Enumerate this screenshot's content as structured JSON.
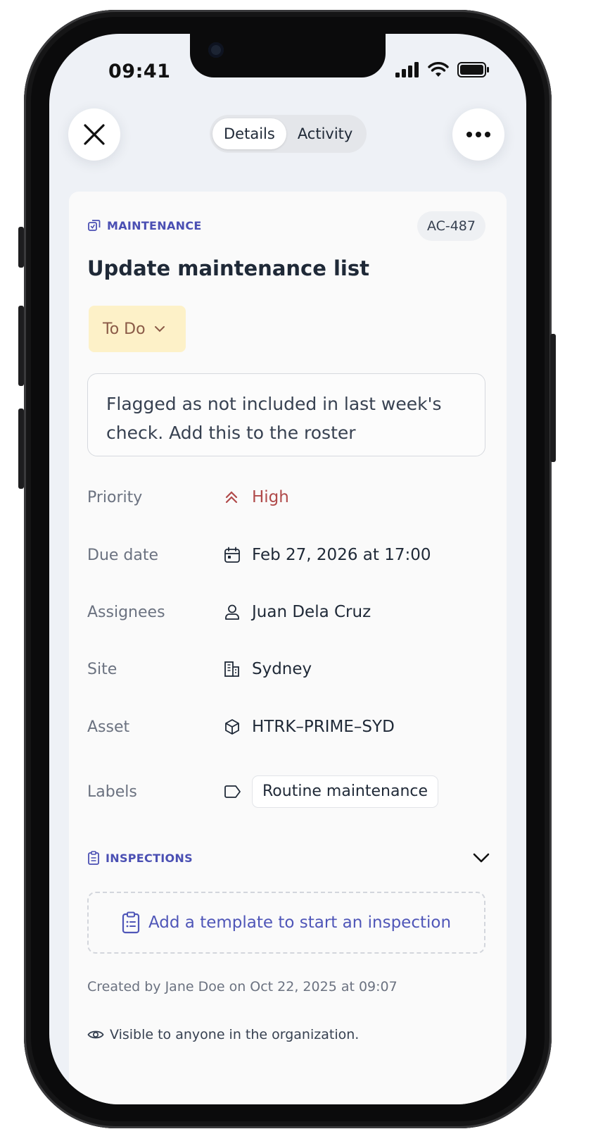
{
  "status_bar": {
    "time": "09:41"
  },
  "header": {
    "tabs": [
      {
        "label": "Details",
        "active": true
      },
      {
        "label": "Activity",
        "active": false
      }
    ]
  },
  "task": {
    "category": "MAINTENANCE",
    "id": "AC-487",
    "title": "Update maintenance list",
    "status": "To Do",
    "description": "Flagged as not included in last week's check. Add this to the roster"
  },
  "fields": {
    "priority": {
      "label": "Priority",
      "value": "High"
    },
    "due_date": {
      "label": "Due date",
      "value": "Feb 27, 2026 at 17:00"
    },
    "assignees": {
      "label": "Assignees",
      "value": "Juan Dela Cruz"
    },
    "site": {
      "label": "Site",
      "value": "Sydney"
    },
    "asset": {
      "label": "Asset",
      "value": "HTRK–PRIME–SYD"
    },
    "labels": {
      "label": "Labels",
      "value": "Routine maintenance"
    }
  },
  "inspections": {
    "heading": "INSPECTIONS",
    "add_label": "Add a template to start an inspection"
  },
  "footer": {
    "created": "Created by Jane Doe on Oct 22, 2025 at 09:07",
    "visibility": "Visible to anyone in the organization."
  },
  "colors": {
    "accent": "#4a4fb3",
    "status_bg": "#fdf1c8",
    "status_text": "#8a5a47",
    "priority_high": "#b04a4a"
  }
}
